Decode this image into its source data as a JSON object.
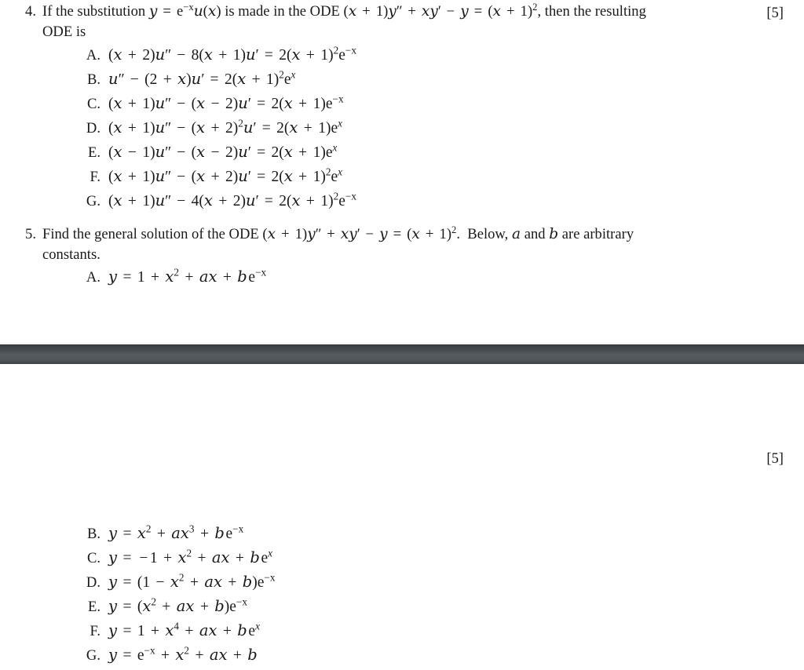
{
  "page": {
    "background_color": "#ffffff",
    "text_color": "#1a1a1a"
  },
  "questions": [
    {
      "number": "4.",
      "marks": "[5]",
      "stem_lines": [
        "If the substitution y = e−ˣu(x) is made in the ODE (x + 1)y″ + xy′ − y = (x + 1)², then the resulting",
        "ODE is"
      ],
      "options": [
        {
          "letter": "A.",
          "text": "(x + 2)u″ − 8(x + 1)u′ = 2(x + 1)²e−ˣ"
        },
        {
          "letter": "B.",
          "text": "u″ − (2 + x)u′ = 2(x + 1)²eˣ"
        },
        {
          "letter": "C.",
          "text": "(x + 1)u″ − (x − 2)u′ = 2(x + 1)e−ˣ"
        },
        {
          "letter": "D.",
          "text": "(x + 1)u″ − (x + 2)²u′ = 2(x + 1)eˣ"
        },
        {
          "letter": "E.",
          "text": "(x − 1)u″ − (x − 2)u′ = 2(x + 1)eˣ"
        },
        {
          "letter": "F.",
          "text": "(x + 1)u″ − (x + 2)u′ = 2(x + 1)²eˣ"
        },
        {
          "letter": "G.",
          "text": "(x + 1)u″ − 4(x + 2)u′ = 2(x + 1)²e−ˣ"
        }
      ]
    },
    {
      "number": "5.",
      "marks": "[5]",
      "stem_lines": [
        "Find the general solution of the ODE (x + 1)y″ + xy′ − y = (x + 1)².  Below, a and b are arbitrary",
        "constants."
      ],
      "options": [
        {
          "letter": "A.",
          "text": "y = 1 + x² + ax + b e−ˣ"
        },
        {
          "letter": "B.",
          "text": "y = x² + ax³ + b e−ˣ"
        },
        {
          "letter": "C.",
          "text": "y = −1 + x² + ax + b eˣ"
        },
        {
          "letter": "D.",
          "text": "y = (1 − x² + ax + b)e−ˣ"
        },
        {
          "letter": "E.",
          "text": "y = (x² + ax + b)e−ˣ"
        },
        {
          "letter": "F.",
          "text": "y = 1 + x⁴ + ax + b eˣ"
        },
        {
          "letter": "G.",
          "text": "y = e−ˣ + x² + ax + b"
        }
      ]
    }
  ],
  "divider": {
    "name": "dark-separator-bar",
    "color_top": "#343a3c",
    "color_mid": "#555c5f",
    "color_bottom": "#3c4245"
  }
}
